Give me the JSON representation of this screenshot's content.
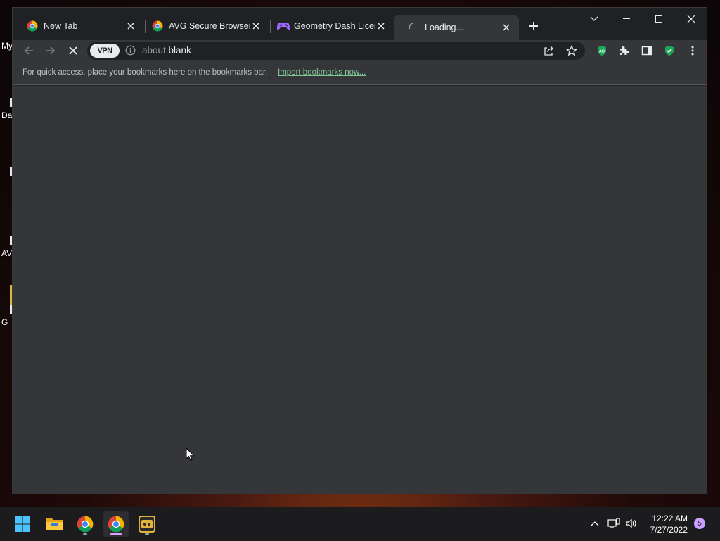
{
  "desktop": {
    "labels": [
      "My",
      "Da",
      "AV",
      "G"
    ]
  },
  "browser": {
    "tabs": [
      {
        "title": "New Tab"
      },
      {
        "title": "AVG Secure Browser F"
      },
      {
        "title": "Geometry Dash Licen"
      },
      {
        "title": "Loading..."
      }
    ],
    "address": {
      "vpn_label": "VPN",
      "url_prefix": "about:",
      "url_host": "blank"
    },
    "bookmarks_bar": {
      "message": "For quick access, place your bookmarks here on the bookmarks bar.",
      "import_link": "Import bookmarks now..."
    },
    "extensions": {
      "adblock_label": "AB"
    }
  },
  "taskbar": {
    "time": "12:22 AM",
    "date": "7/27/2022",
    "notification_count": "5"
  },
  "colors": {
    "tab_bg": "#202124",
    "toolbar_bg": "#35363a",
    "link": "#81c995",
    "accent_purple": "#d6a4ff"
  }
}
